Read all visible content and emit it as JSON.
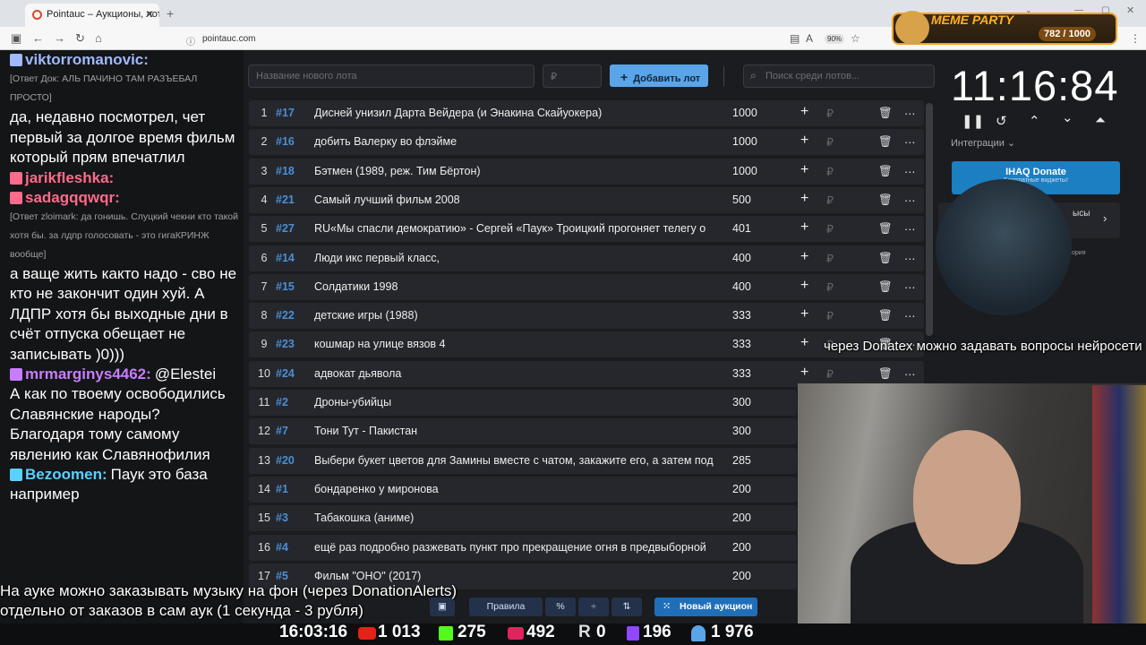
{
  "browser": {
    "tab_title": "Pointauc – Аукционы, лотереи",
    "url": "pointauc.com",
    "zoom": "90%"
  },
  "chat": [
    {
      "type": "nick",
      "nick": "viktorromanovic:",
      "color": "#9fb8ff",
      "text": ""
    },
    {
      "type": "small",
      "text": "[Ответ Док: АЛЬ ПАЧИНО ТАМ РАЗЪЕБАЛ ПРОСТО]"
    },
    {
      "type": "big",
      "text": "да, недавно посмотрел, чет первый за долгое время фильм который прям впечатлил"
    },
    {
      "type": "nick",
      "nick": "jarikfleshka:",
      "color": "#ff6b8a",
      "text": ""
    },
    {
      "type": "nick",
      "nick": "sadagqqwqr:",
      "color": "#ff6b8a",
      "text": ""
    },
    {
      "type": "small",
      "text": "[Ответ zloimark: да гонишь. Слуцкий чекни кто такой хотя бы. за лдпр голосовать - это гигаКРИНЖ вообще]"
    },
    {
      "type": "big",
      "text": "а ваще жить както надо - сво не кто не закончит один хуй. А ЛДПР хотя бы выходные дни в счёт отпуска обещает не записывать )0)))"
    },
    {
      "type": "nick",
      "nick": "mrmarginys4462:",
      "color": "#c77dff",
      "text": "@Elestei"
    },
    {
      "type": "big",
      "text": "А как по твоему освободились Славянские народы? Благодаря тому самому явлению как Славянофилия"
    },
    {
      "type": "nick",
      "nick": "Bezoomen:",
      "color": "#5ad1ff",
      "text": "Паук это база"
    },
    {
      "type": "big",
      "text": "например"
    }
  ],
  "auction": {
    "new_lot_placeholder": "Название нового лота",
    "amount_placeholder": "₽",
    "add_button": "Добавить лот",
    "search_placeholder": "Поиск среди лотов...",
    "lots": [
      {
        "n": "1",
        "id": "#17",
        "name": "Дисней унизил Дарта Вейдера (и Энакина Скайуокера)",
        "amount": "1000"
      },
      {
        "n": "2",
        "id": "#16",
        "name": "добить Валерку во флэйме",
        "amount": "1000"
      },
      {
        "n": "3",
        "id": "#18",
        "name": "Бэтмен (1989, реж. Тим Бёртон)",
        "amount": "1000"
      },
      {
        "n": "4",
        "id": "#21",
        "name": "Самый лучший фильм 2008",
        "amount": "500"
      },
      {
        "n": "5",
        "id": "#27",
        "name": "RU«Мы спасли демократию» - Сергей «Паук» Троицкий прогоняет телегу о",
        "amount": "401"
      },
      {
        "n": "6",
        "id": "#14",
        "name": "Люди икс первый класс,",
        "amount": "400"
      },
      {
        "n": "7",
        "id": "#15",
        "name": "Солдатики 1998",
        "amount": "400"
      },
      {
        "n": "8",
        "id": "#22",
        "name": "детские игры (1988)",
        "amount": "333"
      },
      {
        "n": "9",
        "id": "#23",
        "name": "кошмар на улице вязов 4",
        "amount": "333"
      },
      {
        "n": "10",
        "id": "#24",
        "name": "адвокат дьявола",
        "amount": "333"
      },
      {
        "n": "11",
        "id": "#2",
        "name": "Дроны-убийцы",
        "amount": "300"
      },
      {
        "n": "12",
        "id": "#7",
        "name": "Тони Тут - Пакистан",
        "amount": "300"
      },
      {
        "n": "13",
        "id": "#20",
        "name": "Выбери букет цветов для Замины вместе с чатом, закажите его, а затем под",
        "amount": "285"
      },
      {
        "n": "14",
        "id": "#1",
        "name": "бондаренко у миронова",
        "amount": "200"
      },
      {
        "n": "15",
        "id": "#3",
        "name": "Табакошка (аниме)",
        "amount": "200"
      },
      {
        "n": "16",
        "id": "#4",
        "name": "ещё раз подробно разжевать пункт про прекращение огня в предвыборной",
        "amount": "200"
      },
      {
        "n": "17",
        "id": "#5",
        "name": "Фильм \"ОНО\" (2017)",
        "amount": "200"
      }
    ],
    "rules_button": "Правила",
    "percent_button": "%",
    "new_auction_button": "Новый аукцион"
  },
  "side": {
    "timer": "11:16:84",
    "integrations": "Интеграции",
    "donate_title": "IHAQ Donate",
    "donate_sub": "Бесплатные виджеты!",
    "partial_label_1": "ысы",
    "partial_label_2": "ория"
  },
  "meme": {
    "title": "MEME PARTY",
    "count": "782 / 1000"
  },
  "captions": {
    "donatex": "через Donatex можно задавать вопросы нейросети",
    "music_1": "На ауке можно заказывать музыку на фон (через DonationAlerts)",
    "music_2": "отдельно от заказов в сам аук (1 секунда - 3 рубля)"
  },
  "stats": {
    "time": "16:03:16",
    "youtube": "1 013",
    "kick": "275",
    "live": "492",
    "rumble": "0",
    "twitch": "196",
    "total": "1 976"
  }
}
